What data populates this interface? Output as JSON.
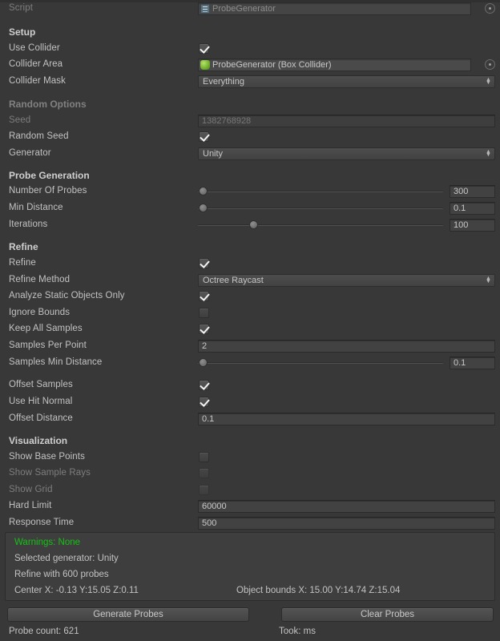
{
  "colors": {
    "background": "#383838",
    "label": "#c2c2c2",
    "label_disabled": "#7d7d7d",
    "field_bg": "#424242",
    "warning_green": "#17c017"
  },
  "script_row": {
    "label": "Script",
    "value": "ProbeGenerator",
    "icon": "script-file-icon",
    "select_button": "object-picker-icon"
  },
  "sections": [
    {
      "title": "Setup",
      "disabled": false,
      "rows": [
        {
          "label": "Use Collider",
          "type": "checkbox",
          "checked": true
        },
        {
          "label": "Collider Area",
          "type": "object",
          "value": "ProbeGenerator (Box Collider)",
          "icon": "box-collider-icon"
        },
        {
          "label": "Collider Mask",
          "type": "popup",
          "value": "Everything"
        }
      ]
    },
    {
      "title": "Random Options",
      "disabled": true,
      "rows": [
        {
          "label": "Seed",
          "type": "text",
          "value": "1382768928",
          "disabled": true
        },
        {
          "label": "Random Seed",
          "type": "checkbox",
          "checked": true
        },
        {
          "label": "Generator",
          "type": "popup",
          "value": "Unity"
        }
      ]
    },
    {
      "title": "Probe Generation",
      "disabled": false,
      "rows": [
        {
          "label": "Number Of Probes",
          "type": "slider",
          "value": "300",
          "fill": 0.015
        },
        {
          "label": "Min Distance",
          "type": "slider",
          "value": "0.1",
          "fill": 0.015
        },
        {
          "label": "Iterations",
          "type": "slider",
          "value": "100",
          "fill": 0.225
        }
      ]
    },
    {
      "title": "Refine",
      "disabled": false,
      "rows": [
        {
          "label": "Refine",
          "type": "checkbox",
          "checked": true
        },
        {
          "label": "Refine Method",
          "type": "popup",
          "value": "Octree Raycast"
        },
        {
          "label": "Analyze Static Objects Only",
          "type": "checkbox",
          "checked": true
        },
        {
          "label": "Ignore Bounds",
          "type": "checkbox",
          "checked": false
        },
        {
          "label": "Keep All Samples",
          "type": "checkbox",
          "checked": true
        },
        {
          "label": "Samples Per Point",
          "type": "text",
          "value": "2"
        },
        {
          "label": "Samples Min Distance",
          "type": "slider",
          "value": "0.1",
          "fill": 0.015
        }
      ]
    },
    {
      "title": null,
      "disabled": false,
      "rows": [
        {
          "label": "Offset Samples",
          "type": "checkbox",
          "checked": true
        },
        {
          "label": "Use Hit Normal",
          "type": "checkbox",
          "checked": true
        },
        {
          "label": "Offset Distance",
          "type": "text",
          "value": "0.1"
        }
      ]
    },
    {
      "title": "Visualization",
      "disabled": false,
      "rows": [
        {
          "label": "Show Base Points",
          "type": "checkbox",
          "checked": false
        },
        {
          "label": "Show Sample Rays",
          "type": "checkbox",
          "checked": false,
          "disabled": true
        },
        {
          "label": "Show Grid",
          "type": "checkbox",
          "checked": false,
          "disabled": true
        },
        {
          "label": "Hard Limit",
          "type": "text",
          "value": "60000"
        },
        {
          "label": "Response Time",
          "type": "text",
          "value": "500"
        }
      ]
    }
  ],
  "info_box": {
    "warnings": "Warnings: None",
    "generator": "Selected generator: Unity",
    "refine": "Refine with 600 probes",
    "center": "Center X: -0.13 Y:15.05 Z:0.11",
    "bounds": "Object bounds X: 15.00 Y:14.74 Z:15.04"
  },
  "buttons": {
    "generate": "Generate Probes",
    "clear": "Clear Probes"
  },
  "status": {
    "probe_count": "Probe count: 621",
    "took": "Took: ms"
  }
}
